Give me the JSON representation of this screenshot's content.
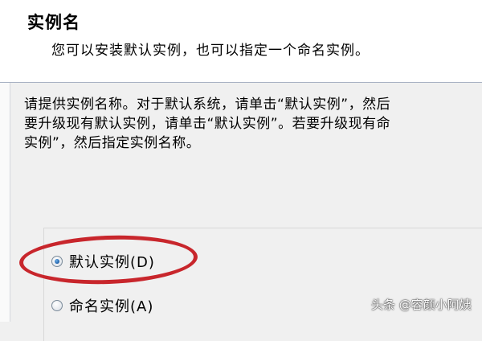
{
  "header": {
    "title": "实例名",
    "subtitle": "您可以安装默认实例，也可以指定一个命名实例。"
  },
  "description": {
    "lines": [
      "请提供实例名称。对于默认系统，请单击“默认实例”，然后",
      "要升级现有默认实例，请单击“默认实例”。若要升级现有命",
      "实例”，然后指定实例名称。"
    ]
  },
  "instance_options": [
    {
      "label": "默认实例(D)",
      "checked": true
    },
    {
      "label": "命名实例(A)",
      "checked": false
    }
  ],
  "annotation": {
    "color": "#c8262c"
  },
  "watermark": "头条 @容颜小阿姨"
}
